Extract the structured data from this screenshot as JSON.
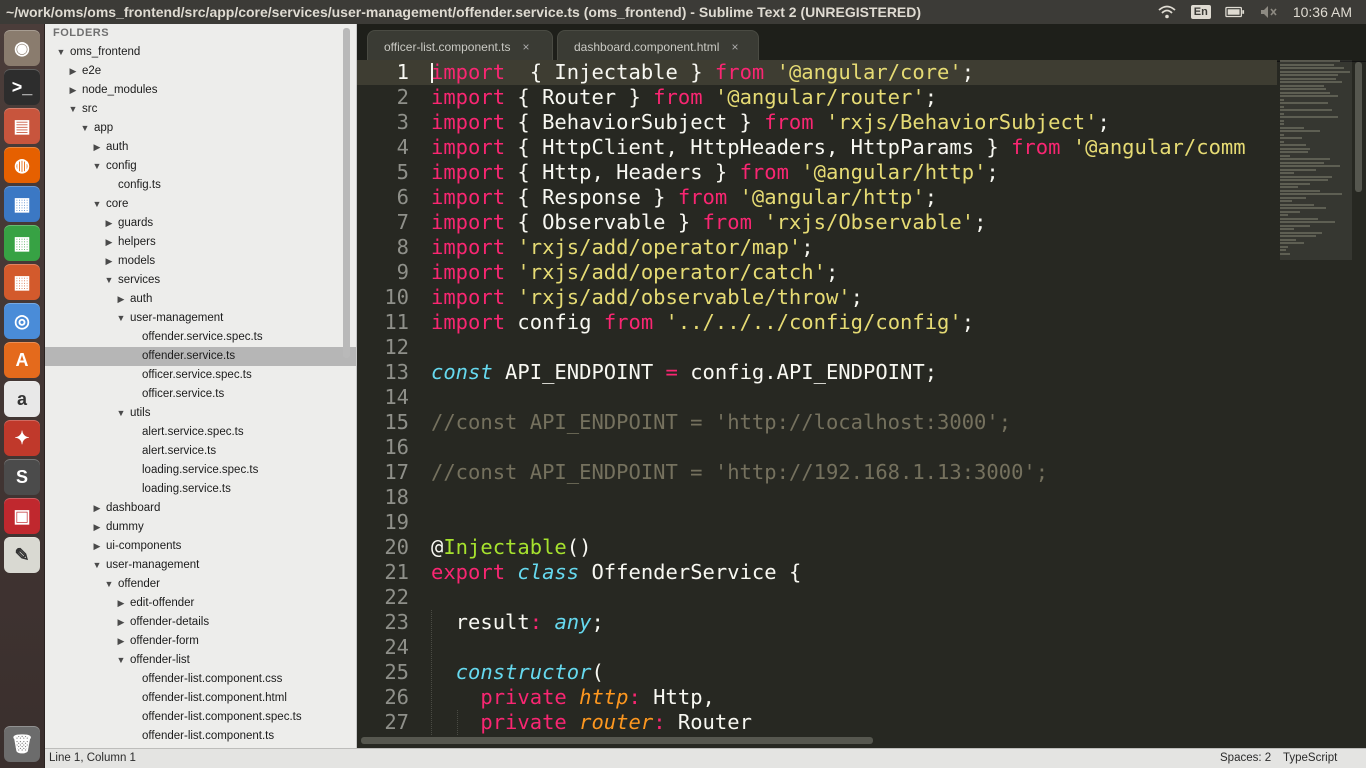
{
  "window": {
    "title": "~/work/oms/oms_frontend/src/app/core/services/user-management/offender.service.ts (oms_frontend) - Sublime Text 2 (UNREGISTERED)"
  },
  "indicators": {
    "keyboard_layout": "En",
    "clock": "10:36 AM",
    "icons": [
      "wifi-icon",
      "keyboard-layout-icon",
      "battery-icon",
      "volume-muted-icon"
    ]
  },
  "launcher": {
    "items": [
      {
        "name": "ubuntu-dash-icon",
        "glyph": "◉",
        "color": "#8a7c6e"
      },
      {
        "name": "terminal-icon",
        "glyph": ">_",
        "color": "#2d2d2d"
      },
      {
        "name": "files-icon",
        "glyph": "▤",
        "color": "#c8553d"
      },
      {
        "name": "firefox-icon",
        "glyph": "◍",
        "color": "#e66000"
      },
      {
        "name": "libreoffice-writer-icon",
        "glyph": "▦",
        "color": "#3b78c4"
      },
      {
        "name": "libreoffice-calc-icon",
        "glyph": "▦",
        "color": "#37a244"
      },
      {
        "name": "libreoffice-impress-icon",
        "glyph": "▦",
        "color": "#d35a2c"
      },
      {
        "name": "chrome-icon",
        "glyph": "◎",
        "color": "#4a8cd8"
      },
      {
        "name": "software-center-icon",
        "glyph": "A",
        "color": "#e46a1c"
      },
      {
        "name": "amazon-icon",
        "glyph": "a",
        "color": "#e8e8e8"
      },
      {
        "name": "system-settings-icon",
        "glyph": "✦",
        "color": "#c0392b"
      },
      {
        "name": "sublime-text-icon",
        "glyph": "S",
        "color": "#4b4b4b"
      },
      {
        "name": "workspace-switcher-icon",
        "glyph": "▣",
        "color": "#c0282e"
      },
      {
        "name": "text-editor-icon",
        "glyph": "✎",
        "color": "#d9d9d2"
      }
    ],
    "trash": {
      "name": "trash-icon",
      "glyph": "🗑",
      "color": "#6c6c6c"
    }
  },
  "sidebar": {
    "header": "FOLDERS",
    "tree": [
      {
        "label": "oms_frontend",
        "depth": 0,
        "arrow": "open"
      },
      {
        "label": "e2e",
        "depth": 1,
        "arrow": "closed"
      },
      {
        "label": "node_modules",
        "depth": 1,
        "arrow": "closed"
      },
      {
        "label": "src",
        "depth": 1,
        "arrow": "open"
      },
      {
        "label": "app",
        "depth": 2,
        "arrow": "open"
      },
      {
        "label": "auth",
        "depth": 3,
        "arrow": "closed"
      },
      {
        "label": "config",
        "depth": 3,
        "arrow": "open"
      },
      {
        "label": "config.ts",
        "depth": 4,
        "arrow": "none"
      },
      {
        "label": "core",
        "depth": 3,
        "arrow": "open"
      },
      {
        "label": "guards",
        "depth": 4,
        "arrow": "closed"
      },
      {
        "label": "helpers",
        "depth": 4,
        "arrow": "closed"
      },
      {
        "label": "models",
        "depth": 4,
        "arrow": "closed"
      },
      {
        "label": "services",
        "depth": 4,
        "arrow": "open"
      },
      {
        "label": "auth",
        "depth": 5,
        "arrow": "closed"
      },
      {
        "label": "user-management",
        "depth": 5,
        "arrow": "open"
      },
      {
        "label": "offender.service.spec.ts",
        "depth": 6,
        "arrow": "none"
      },
      {
        "label": "offender.service.ts",
        "depth": 6,
        "arrow": "none",
        "selected": true
      },
      {
        "label": "officer.service.spec.ts",
        "depth": 6,
        "arrow": "none"
      },
      {
        "label": "officer.service.ts",
        "depth": 6,
        "arrow": "none"
      },
      {
        "label": "utils",
        "depth": 5,
        "arrow": "open"
      },
      {
        "label": "alert.service.spec.ts",
        "depth": 6,
        "arrow": "none"
      },
      {
        "label": "alert.service.ts",
        "depth": 6,
        "arrow": "none"
      },
      {
        "label": "loading.service.spec.ts",
        "depth": 6,
        "arrow": "none"
      },
      {
        "label": "loading.service.ts",
        "depth": 6,
        "arrow": "none"
      },
      {
        "label": "dashboard",
        "depth": 3,
        "arrow": "closed"
      },
      {
        "label": "dummy",
        "depth": 3,
        "arrow": "closed"
      },
      {
        "label": "ui-components",
        "depth": 3,
        "arrow": "closed"
      },
      {
        "label": "user-management",
        "depth": 3,
        "arrow": "open"
      },
      {
        "label": "offender",
        "depth": 4,
        "arrow": "open"
      },
      {
        "label": "edit-offender",
        "depth": 5,
        "arrow": "closed"
      },
      {
        "label": "offender-details",
        "depth": 5,
        "arrow": "closed"
      },
      {
        "label": "offender-form",
        "depth": 5,
        "arrow": "closed"
      },
      {
        "label": "offender-list",
        "depth": 5,
        "arrow": "open"
      },
      {
        "label": "offender-list.component.css",
        "depth": 6,
        "arrow": "none"
      },
      {
        "label": "offender-list.component.html",
        "depth": 6,
        "arrow": "none"
      },
      {
        "label": "offender-list.component.spec.ts",
        "depth": 6,
        "arrow": "none"
      },
      {
        "label": "offender-list.component.ts",
        "depth": 6,
        "arrow": "none"
      }
    ]
  },
  "tabs": [
    {
      "label": "officer-list.component.ts",
      "close": "×"
    },
    {
      "label": "dashboard.component.html",
      "close": "×"
    }
  ],
  "code": [
    {
      "n": "1",
      "current": true,
      "tokens": [
        [
          "kw",
          "import"
        ],
        [
          "",
          "  { Injectable } "
        ],
        [
          "kw",
          "from"
        ],
        [
          "",
          " "
        ],
        [
          "str",
          "'@angular/core'"
        ],
        [
          "",
          ";"
        ]
      ]
    },
    {
      "n": "2",
      "tokens": [
        [
          "kw",
          "import"
        ],
        [
          "",
          " { Router } "
        ],
        [
          "kw",
          "from"
        ],
        [
          "",
          " "
        ],
        [
          "str",
          "'@angular/router'"
        ],
        [
          "",
          ";"
        ]
      ]
    },
    {
      "n": "3",
      "tokens": [
        [
          "kw",
          "import"
        ],
        [
          "",
          " { BehaviorSubject } "
        ],
        [
          "kw",
          "from"
        ],
        [
          "",
          " "
        ],
        [
          "str",
          "'rxjs/BehaviorSubject'"
        ],
        [
          "",
          ";"
        ]
      ]
    },
    {
      "n": "4",
      "tokens": [
        [
          "kw",
          "import"
        ],
        [
          "",
          " { HttpClient, HttpHeaders, HttpParams } "
        ],
        [
          "kw",
          "from"
        ],
        [
          "",
          " "
        ],
        [
          "str",
          "'@angular/comm"
        ]
      ]
    },
    {
      "n": "5",
      "tokens": [
        [
          "kw",
          "import"
        ],
        [
          "",
          " { Http, Headers } "
        ],
        [
          "kw",
          "from"
        ],
        [
          "",
          " "
        ],
        [
          "str",
          "'@angular/http'"
        ],
        [
          "",
          ";"
        ]
      ]
    },
    {
      "n": "6",
      "tokens": [
        [
          "kw",
          "import"
        ],
        [
          "",
          " { Response } "
        ],
        [
          "kw",
          "from"
        ],
        [
          "",
          " "
        ],
        [
          "str",
          "'@angular/http'"
        ],
        [
          "",
          ";"
        ]
      ]
    },
    {
      "n": "7",
      "tokens": [
        [
          "kw",
          "import"
        ],
        [
          "",
          " { Observable } "
        ],
        [
          "kw",
          "from"
        ],
        [
          "",
          " "
        ],
        [
          "str",
          "'rxjs/Observable'"
        ],
        [
          "",
          ";"
        ]
      ]
    },
    {
      "n": "8",
      "tokens": [
        [
          "kw",
          "import"
        ],
        [
          "",
          " "
        ],
        [
          "str",
          "'rxjs/add/operator/map'"
        ],
        [
          "",
          ";"
        ]
      ]
    },
    {
      "n": "9",
      "tokens": [
        [
          "kw",
          "import"
        ],
        [
          "",
          " "
        ],
        [
          "str",
          "'rxjs/add/operator/catch'"
        ],
        [
          "",
          ";"
        ]
      ]
    },
    {
      "n": "10",
      "tokens": [
        [
          "kw",
          "import"
        ],
        [
          "",
          " "
        ],
        [
          "str",
          "'rxjs/add/observable/throw'"
        ],
        [
          "",
          ";"
        ]
      ]
    },
    {
      "n": "11",
      "tokens": [
        [
          "kw",
          "import"
        ],
        [
          "",
          " config "
        ],
        [
          "kw",
          "from"
        ],
        [
          "",
          " "
        ],
        [
          "str",
          "'../../../config/config'"
        ],
        [
          "",
          ";"
        ]
      ]
    },
    {
      "n": "12",
      "tokens": []
    },
    {
      "n": "13",
      "tokens": [
        [
          "sto",
          "const"
        ],
        [
          "",
          " API_ENDPOINT "
        ],
        [
          "kw",
          "="
        ],
        [
          "",
          " config.API_ENDPOINT;"
        ]
      ]
    },
    {
      "n": "14",
      "tokens": []
    },
    {
      "n": "15",
      "tokens": [
        [
          "cm",
          "//const API_ENDPOINT = 'http://localhost:3000';"
        ]
      ]
    },
    {
      "n": "16",
      "tokens": []
    },
    {
      "n": "17",
      "tokens": [
        [
          "cm",
          "//const API_ENDPOINT = 'http://192.168.1.13:3000';"
        ]
      ]
    },
    {
      "n": "18",
      "tokens": []
    },
    {
      "n": "19",
      "tokens": []
    },
    {
      "n": "20",
      "tokens": [
        [
          "",
          "@"
        ],
        [
          "fn",
          "Injectable"
        ],
        [
          "",
          "()"
        ]
      ]
    },
    {
      "n": "21",
      "tokens": [
        [
          "kw",
          "export"
        ],
        [
          "",
          " "
        ],
        [
          "sto",
          "class"
        ],
        [
          "",
          " OffenderService {"
        ]
      ]
    },
    {
      "n": "22",
      "tokens": []
    },
    {
      "n": "23",
      "tokens": [
        [
          "",
          "  result"
        ],
        [
          "kw",
          ":"
        ],
        [
          "",
          " "
        ],
        [
          "sto",
          "any"
        ],
        [
          "",
          ";"
        ]
      ]
    },
    {
      "n": "24",
      "tokens": []
    },
    {
      "n": "25",
      "tokens": [
        [
          "",
          "  "
        ],
        [
          "sto",
          "constructor"
        ],
        [
          "",
          "("
        ]
      ]
    },
    {
      "n": "26",
      "tokens": [
        [
          "",
          "    "
        ],
        [
          "kw",
          "private"
        ],
        [
          "",
          " "
        ],
        [
          "param",
          "http"
        ],
        [
          "kw",
          ":"
        ],
        [
          "",
          " Http,"
        ]
      ]
    },
    {
      "n": "27",
      "tokens": [
        [
          "",
          "    "
        ],
        [
          "kw",
          "private"
        ],
        [
          "",
          " "
        ],
        [
          "param",
          "router"
        ],
        [
          "kw",
          ":"
        ],
        [
          "",
          " Router"
        ]
      ]
    }
  ],
  "statusbar": {
    "position": "Line 1, Column 1",
    "spaces": "Spaces: 2",
    "syntax": "TypeScript"
  }
}
